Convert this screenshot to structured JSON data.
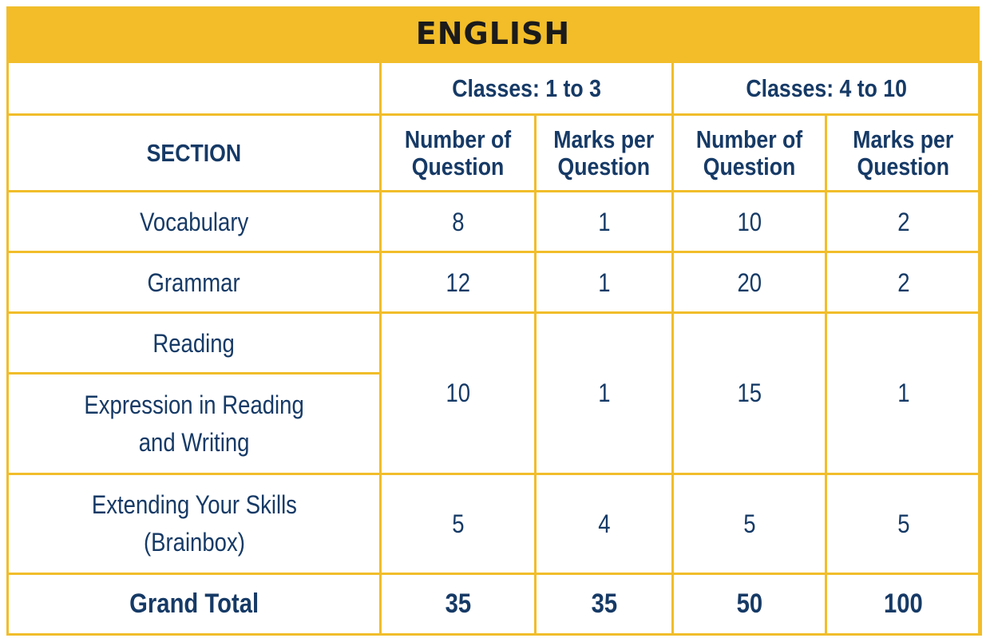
{
  "title": "ENGLISH",
  "header": {
    "group_1": "Classes: 1 to 3",
    "group_2": "Classes: 4 to 10",
    "section_label": "SECTION",
    "col_num_q_line1": "Number of",
    "col_num_q_line2": "Question",
    "col_marks_line1": "Marks per",
    "col_marks_line2": "Question"
  },
  "rows": [
    {
      "section": "Vocabulary",
      "c13_num": "8",
      "c13_marks": "1",
      "c410_num": "10",
      "c410_marks": "2"
    },
    {
      "section": "Grammar",
      "c13_num": "12",
      "c13_marks": "1",
      "c410_num": "20",
      "c410_marks": "2"
    },
    {
      "section": "Reading",
      "c13_num": "10",
      "c13_marks": "1",
      "c410_num": "15",
      "c410_marks": "1"
    },
    {
      "section_line1": "Expression in Reading",
      "section_line2": "and Writing"
    },
    {
      "section_line1": "Extending Your Skills",
      "section_line2": "(Brainbox)",
      "c13_num": "5",
      "c13_marks": "4",
      "c410_num": "5",
      "c410_marks": "5"
    }
  ],
  "total": {
    "label": "Grand Total",
    "c13_num": "35",
    "c13_marks": "35",
    "c410_num": "50",
    "c410_marks": "100"
  },
  "colors": {
    "accent_yellow": "#f3bd29",
    "text_navy": "#163a66",
    "title_text": "#1b1b1b"
  }
}
